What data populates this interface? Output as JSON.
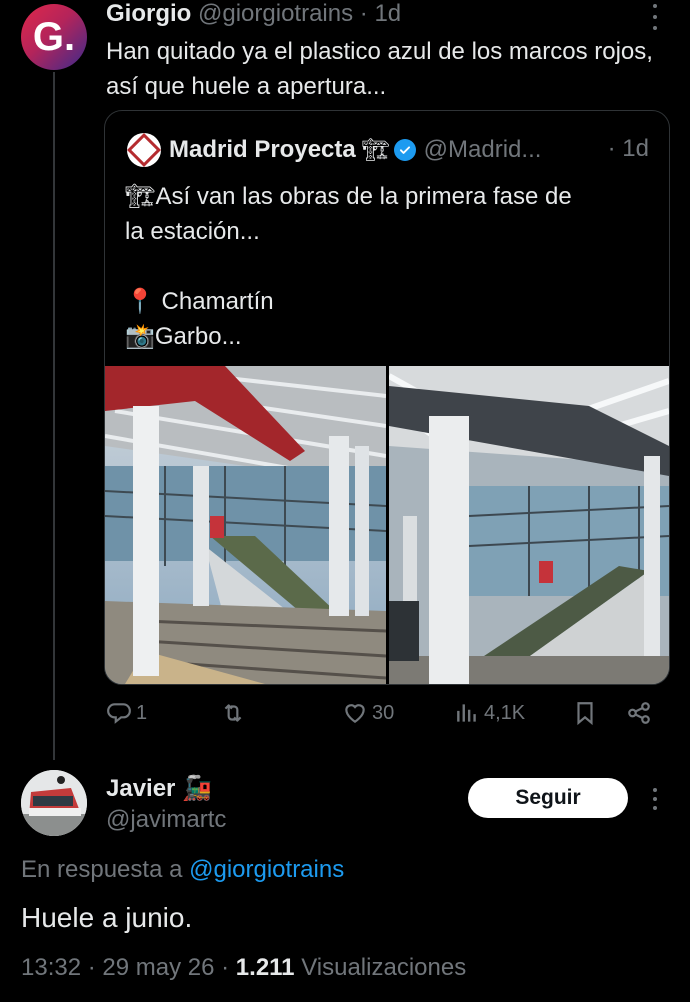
{
  "tweet1": {
    "avatar_letter": "G.",
    "name": "Giorgio",
    "handle": "@giorgiotrains",
    "time": "· 1d",
    "text": "Han quitado ya el plastico azul de los marcos rojos, así que huele a apertura..."
  },
  "quote": {
    "name": "Madrid Proyecta",
    "name_emoji": "🏗",
    "handle": "@Madrid...",
    "time": "· 1d",
    "lines": [
      "🏗Así van las obras de la primera fase de",
      "la estación...",
      "",
      "📍 Chamartín",
      "📸Garbo..."
    ]
  },
  "actions": {
    "replies": "1",
    "retweets": "",
    "likes": "30",
    "views": "4,1K"
  },
  "tweet2": {
    "name": "Javier",
    "name_emoji": "🚂",
    "handle": "@javimartc",
    "follow_label": "Seguir",
    "reply_prefix": "En respuesta a",
    "reply_handle": "@giorgiotrains",
    "text": "Huele a junio.",
    "meta_time": "13:32 · 29 may 26 ·",
    "views_count": "1.211",
    "views_label": "Visualizaciones"
  },
  "colors": {
    "background": "#000000",
    "text": "#e7e9ea",
    "muted": "#71767b",
    "link": "#1d9bf0",
    "border": "#2f3336"
  },
  "icons": [
    "more-icon",
    "verified-icon",
    "reply-icon",
    "retweet-icon",
    "like-icon",
    "views-icon",
    "bookmark-icon",
    "share-icon"
  ]
}
